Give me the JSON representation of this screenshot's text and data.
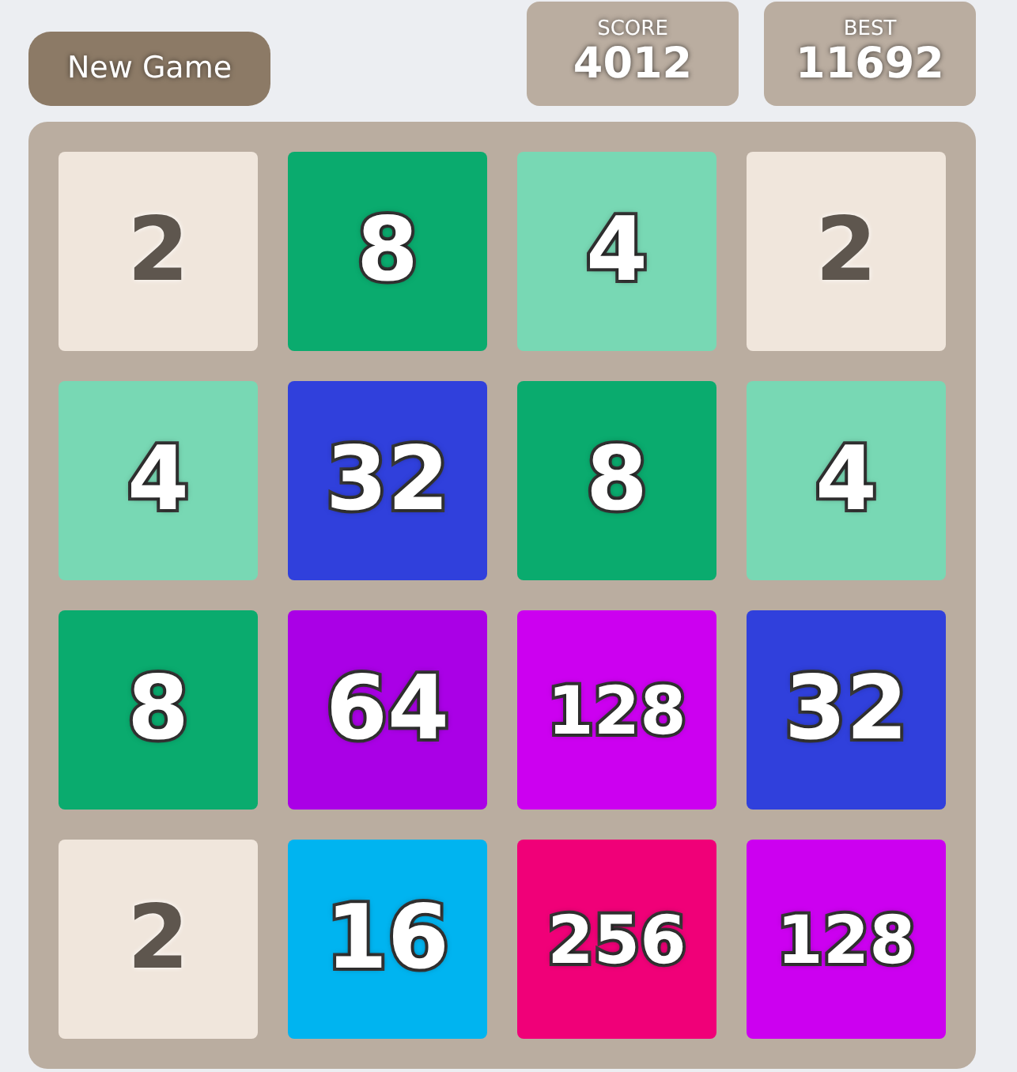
{
  "new_game_button": "New Game",
  "scores": [
    {
      "label": "SCORE",
      "value": "4012"
    },
    {
      "label": "BEST",
      "value": "11692"
    }
  ],
  "tiles": [
    {
      "value": "2",
      "color": "#f0e6dc"
    },
    {
      "value": "8",
      "color": "#0aab6e"
    },
    {
      "value": "4",
      "color": "#78d8b4"
    },
    {
      "value": "2",
      "color": "#f0e6dc"
    },
    {
      "value": "4",
      "color": "#78d8b4"
    },
    {
      "value": "32",
      "color": "#3040dc"
    },
    {
      "value": "8",
      "color": "#0aab6e"
    },
    {
      "value": "4",
      "color": "#78d8b4"
    },
    {
      "value": "8",
      "color": "#0aab6e"
    },
    {
      "value": "64",
      "color": "#aa00e6"
    },
    {
      "value": "128",
      "color": "#cc00f0"
    },
    {
      "value": "32",
      "color": "#3040dc"
    },
    {
      "value": "2",
      "color": "#f0e6dc"
    },
    {
      "value": "16",
      "color": "#00b4f0"
    },
    {
      "value": "256",
      "color": "#f00078"
    },
    {
      "value": "128",
      "color": "#cc00f0"
    }
  ]
}
